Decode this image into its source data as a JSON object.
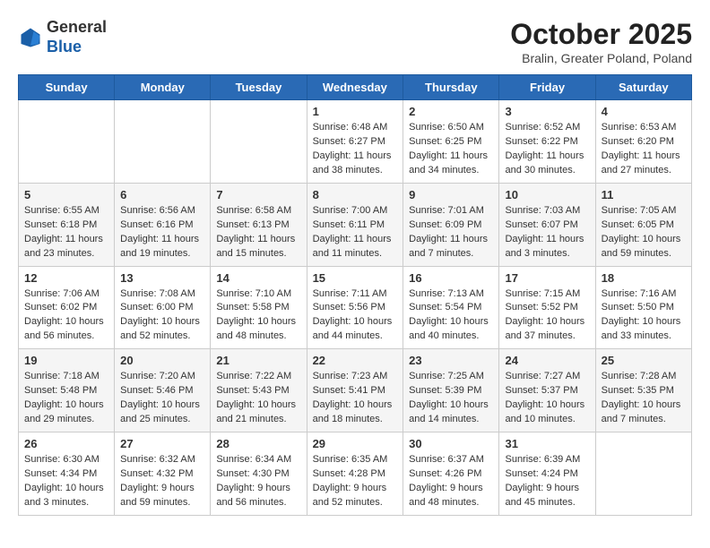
{
  "header": {
    "logo_general": "General",
    "logo_blue": "Blue",
    "month_year": "October 2025",
    "location": "Bralin, Greater Poland, Poland"
  },
  "days_of_week": [
    "Sunday",
    "Monday",
    "Tuesday",
    "Wednesday",
    "Thursday",
    "Friday",
    "Saturday"
  ],
  "weeks": [
    [
      {
        "day": "",
        "content": ""
      },
      {
        "day": "",
        "content": ""
      },
      {
        "day": "",
        "content": ""
      },
      {
        "day": "1",
        "content": "Sunrise: 6:48 AM\nSunset: 6:27 PM\nDaylight: 11 hours and 38 minutes."
      },
      {
        "day": "2",
        "content": "Sunrise: 6:50 AM\nSunset: 6:25 PM\nDaylight: 11 hours and 34 minutes."
      },
      {
        "day": "3",
        "content": "Sunrise: 6:52 AM\nSunset: 6:22 PM\nDaylight: 11 hours and 30 minutes."
      },
      {
        "day": "4",
        "content": "Sunrise: 6:53 AM\nSunset: 6:20 PM\nDaylight: 11 hours and 27 minutes."
      }
    ],
    [
      {
        "day": "5",
        "content": "Sunrise: 6:55 AM\nSunset: 6:18 PM\nDaylight: 11 hours and 23 minutes."
      },
      {
        "day": "6",
        "content": "Sunrise: 6:56 AM\nSunset: 6:16 PM\nDaylight: 11 hours and 19 minutes."
      },
      {
        "day": "7",
        "content": "Sunrise: 6:58 AM\nSunset: 6:13 PM\nDaylight: 11 hours and 15 minutes."
      },
      {
        "day": "8",
        "content": "Sunrise: 7:00 AM\nSunset: 6:11 PM\nDaylight: 11 hours and 11 minutes."
      },
      {
        "day": "9",
        "content": "Sunrise: 7:01 AM\nSunset: 6:09 PM\nDaylight: 11 hours and 7 minutes."
      },
      {
        "day": "10",
        "content": "Sunrise: 7:03 AM\nSunset: 6:07 PM\nDaylight: 11 hours and 3 minutes."
      },
      {
        "day": "11",
        "content": "Sunrise: 7:05 AM\nSunset: 6:05 PM\nDaylight: 10 hours and 59 minutes."
      }
    ],
    [
      {
        "day": "12",
        "content": "Sunrise: 7:06 AM\nSunset: 6:02 PM\nDaylight: 10 hours and 56 minutes."
      },
      {
        "day": "13",
        "content": "Sunrise: 7:08 AM\nSunset: 6:00 PM\nDaylight: 10 hours and 52 minutes."
      },
      {
        "day": "14",
        "content": "Sunrise: 7:10 AM\nSunset: 5:58 PM\nDaylight: 10 hours and 48 minutes."
      },
      {
        "day": "15",
        "content": "Sunrise: 7:11 AM\nSunset: 5:56 PM\nDaylight: 10 hours and 44 minutes."
      },
      {
        "day": "16",
        "content": "Sunrise: 7:13 AM\nSunset: 5:54 PM\nDaylight: 10 hours and 40 minutes."
      },
      {
        "day": "17",
        "content": "Sunrise: 7:15 AM\nSunset: 5:52 PM\nDaylight: 10 hours and 37 minutes."
      },
      {
        "day": "18",
        "content": "Sunrise: 7:16 AM\nSunset: 5:50 PM\nDaylight: 10 hours and 33 minutes."
      }
    ],
    [
      {
        "day": "19",
        "content": "Sunrise: 7:18 AM\nSunset: 5:48 PM\nDaylight: 10 hours and 29 minutes."
      },
      {
        "day": "20",
        "content": "Sunrise: 7:20 AM\nSunset: 5:46 PM\nDaylight: 10 hours and 25 minutes."
      },
      {
        "day": "21",
        "content": "Sunrise: 7:22 AM\nSunset: 5:43 PM\nDaylight: 10 hours and 21 minutes."
      },
      {
        "day": "22",
        "content": "Sunrise: 7:23 AM\nSunset: 5:41 PM\nDaylight: 10 hours and 18 minutes."
      },
      {
        "day": "23",
        "content": "Sunrise: 7:25 AM\nSunset: 5:39 PM\nDaylight: 10 hours and 14 minutes."
      },
      {
        "day": "24",
        "content": "Sunrise: 7:27 AM\nSunset: 5:37 PM\nDaylight: 10 hours and 10 minutes."
      },
      {
        "day": "25",
        "content": "Sunrise: 7:28 AM\nSunset: 5:35 PM\nDaylight: 10 hours and 7 minutes."
      }
    ],
    [
      {
        "day": "26",
        "content": "Sunrise: 6:30 AM\nSunset: 4:34 PM\nDaylight: 10 hours and 3 minutes."
      },
      {
        "day": "27",
        "content": "Sunrise: 6:32 AM\nSunset: 4:32 PM\nDaylight: 9 hours and 59 minutes."
      },
      {
        "day": "28",
        "content": "Sunrise: 6:34 AM\nSunset: 4:30 PM\nDaylight: 9 hours and 56 minutes."
      },
      {
        "day": "29",
        "content": "Sunrise: 6:35 AM\nSunset: 4:28 PM\nDaylight: 9 hours and 52 minutes."
      },
      {
        "day": "30",
        "content": "Sunrise: 6:37 AM\nSunset: 4:26 PM\nDaylight: 9 hours and 48 minutes."
      },
      {
        "day": "31",
        "content": "Sunrise: 6:39 AM\nSunset: 4:24 PM\nDaylight: 9 hours and 45 minutes."
      },
      {
        "day": "",
        "content": ""
      }
    ]
  ]
}
